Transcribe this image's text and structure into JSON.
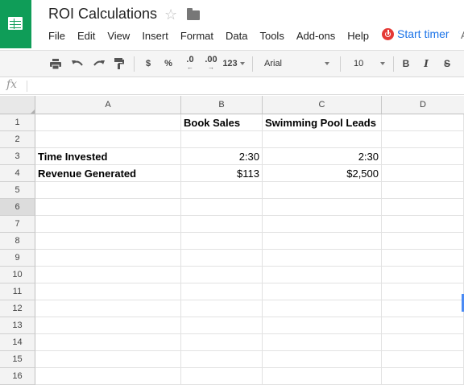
{
  "doc": {
    "title": "ROI Calculations",
    "star": "☆"
  },
  "menu": [
    "File",
    "Edit",
    "View",
    "Insert",
    "Format",
    "Data",
    "Tools",
    "Add-ons",
    "Help"
  ],
  "timer": {
    "label": "Start timer"
  },
  "menu_overflow": "A",
  "toolbar": {
    "currency": "$",
    "percent": "%",
    "dec_less": ".0",
    "dec_more": ".00",
    "more_formats": "123",
    "font": "Arial",
    "size": "10",
    "bold": "B",
    "italic": "I",
    "strike": "S"
  },
  "formula": {
    "fx": "fx",
    "value": ""
  },
  "columns": [
    "A",
    "B",
    "C",
    "D"
  ],
  "rows": [
    [
      "1",
      "",
      "Book Sales",
      "Swimming Pool Leads",
      ""
    ],
    [
      "2",
      "",
      "",
      "",
      ""
    ],
    [
      "3",
      "Time Invested",
      "2:30",
      "2:30",
      ""
    ],
    [
      "4",
      "Revenue Generated",
      "$113",
      "$2,500",
      ""
    ],
    [
      "5",
      "",
      "",
      "",
      ""
    ],
    [
      "6",
      "",
      "",
      "",
      ""
    ],
    [
      "7",
      "",
      "",
      "",
      ""
    ],
    [
      "8",
      "",
      "",
      "",
      ""
    ],
    [
      "9",
      "",
      "",
      "",
      ""
    ],
    [
      "10",
      "",
      "",
      "",
      ""
    ],
    [
      "11",
      "",
      "",
      "",
      ""
    ],
    [
      "12",
      "",
      "",
      "",
      ""
    ],
    [
      "13",
      "",
      "",
      "",
      ""
    ],
    [
      "14",
      "",
      "",
      "",
      ""
    ],
    [
      "15",
      "",
      "",
      "",
      ""
    ],
    [
      "16",
      "",
      "",
      "",
      ""
    ]
  ],
  "colors": {
    "brand": "#0f9d58",
    "link": "#1a73e8",
    "timer_icon": "#e53935",
    "selection": "#4a8af4"
  }
}
